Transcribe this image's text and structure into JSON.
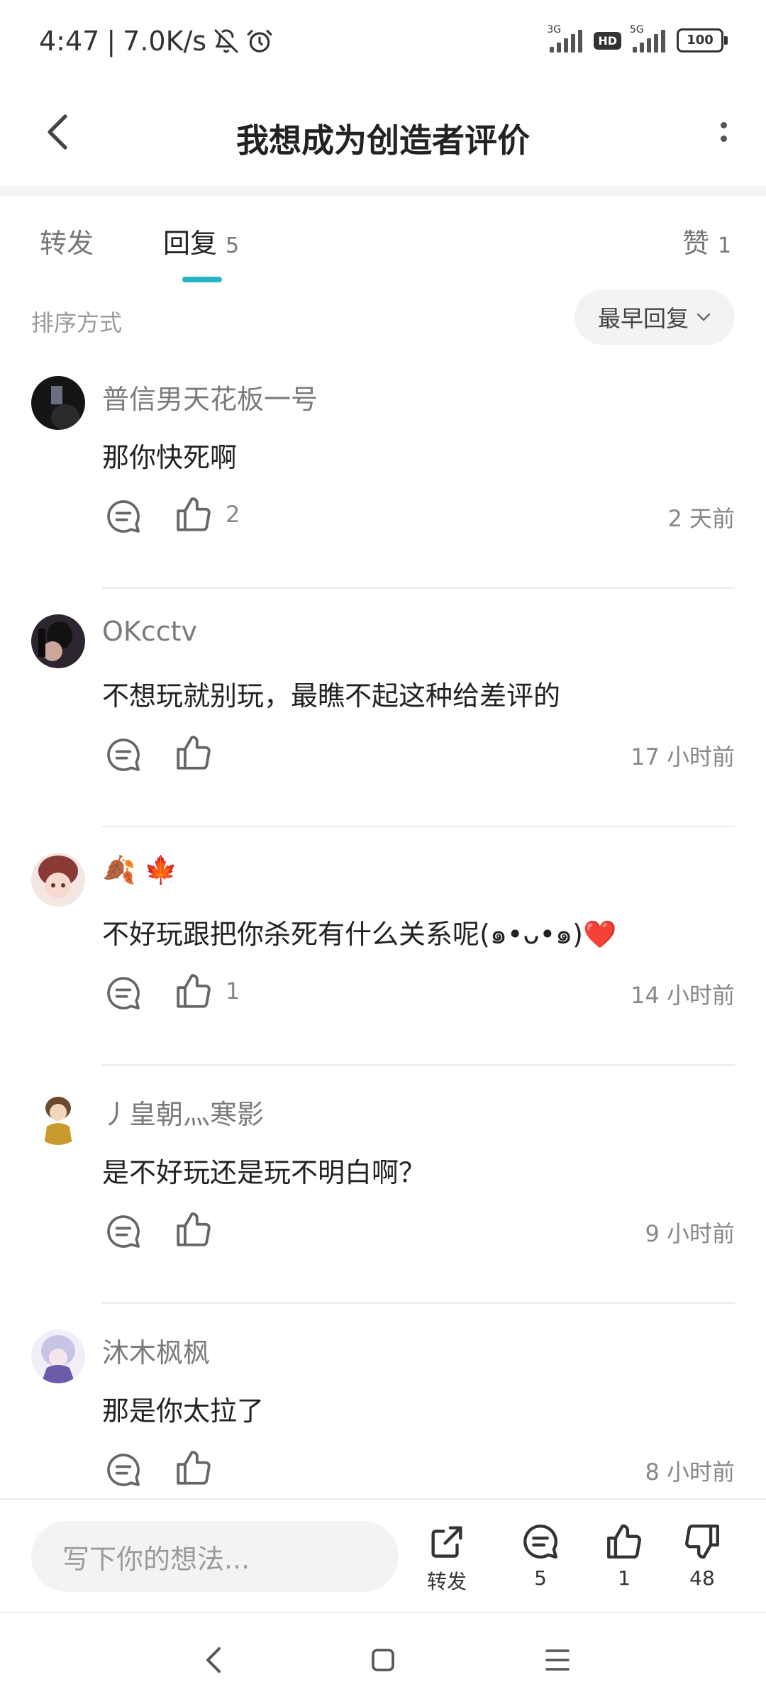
{
  "status_bar": {
    "time": "4:47",
    "speed": "7.0K/s",
    "net1": "3G",
    "net2": "5G",
    "hd": "HD",
    "battery": "100",
    "icons": [
      "bell-off-icon",
      "alarm-icon"
    ]
  },
  "header": {
    "title": "我想成为创造者评价",
    "back_icon": "chevron-left-icon",
    "more_icon": "more-vertical-icon"
  },
  "tabs": [
    {
      "label": "转发",
      "count": ""
    },
    {
      "label": "回复",
      "count": "5",
      "active": true
    },
    {
      "label": "赞",
      "count": "1"
    }
  ],
  "sort": {
    "label": "排序方式",
    "selected": "最早回复"
  },
  "comments": [
    {
      "username": "普信男天花板一号",
      "content": "那你快死啊",
      "likes": "2",
      "time": "2 天前",
      "avatar_color": "#1a1a1a"
    },
    {
      "username": "OKcctv",
      "content": "不想玩就别玩，最瞧不起这种给差评的",
      "likes": "",
      "time": "17 小时前",
      "avatar_color": "#2b2530"
    },
    {
      "username": "🍂 🍁",
      "content": "不好玩跟把你杀死有什么关系呢(๑•ᴗ•๑)❤️",
      "likes": "1",
      "time": "14 小时前",
      "avatar_color": "#a0443f"
    },
    {
      "username": "丿皇朝灬寒影",
      "content": "是不好玩还是玩不明白啊？",
      "likes": "",
      "time": "9 小时前",
      "avatar_color": "#b88a4a"
    },
    {
      "username": "沐木枫枫",
      "content": "那是你太拉了",
      "likes": "",
      "time": "8 小时前",
      "avatar_color": "#8a7fc4"
    }
  ],
  "bottom_bar": {
    "input_placeholder": "写下你的想法...",
    "share_label": "转发",
    "comment_count": "5",
    "like_count": "1",
    "dislike_count": "48"
  },
  "colors": {
    "accent": "#27b4c2",
    "text_primary": "#222222",
    "text_secondary": "#888888"
  }
}
